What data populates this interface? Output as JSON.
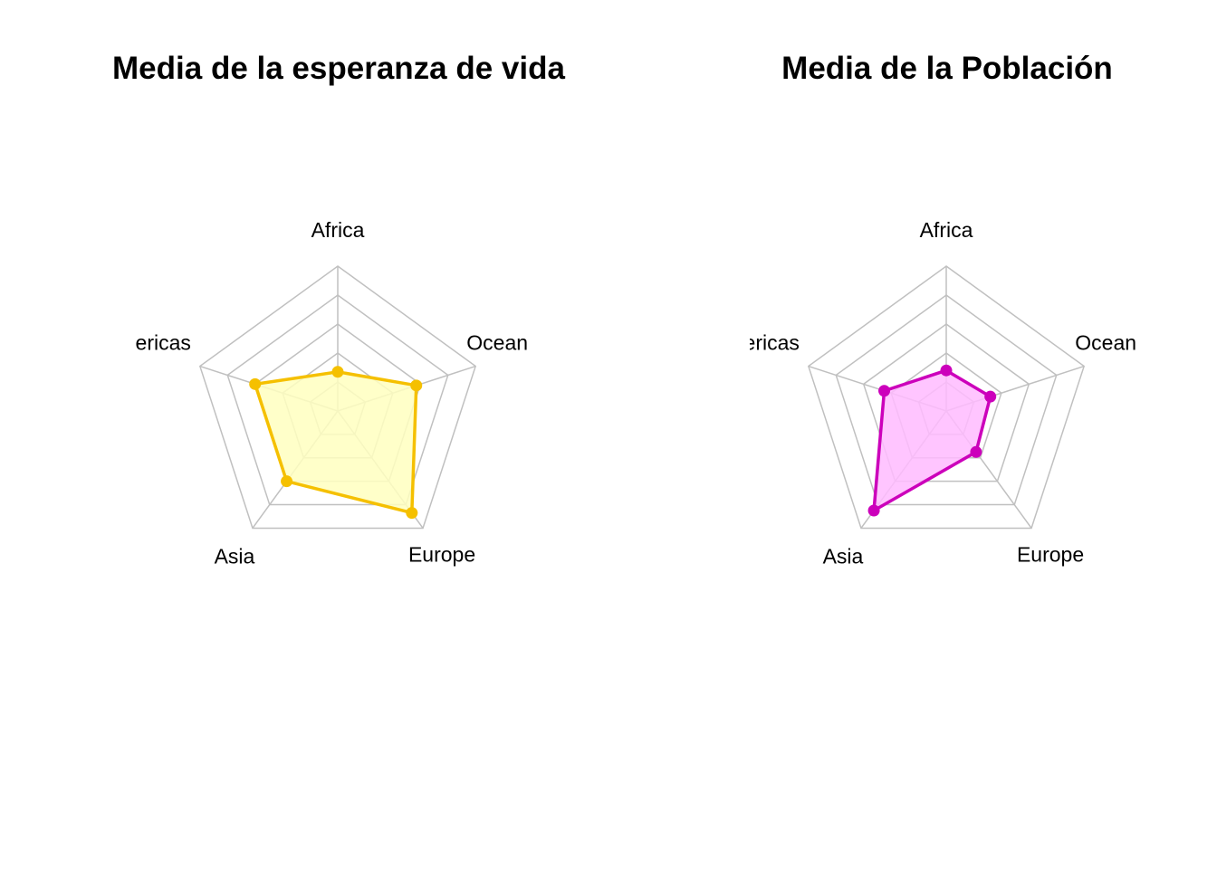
{
  "chart_data": [
    {
      "type": "radar",
      "title": "Media de la esperanza de vida",
      "axes": [
        "Africa",
        "Oceania",
        "Europe",
        "Asia",
        "Americas"
      ],
      "axis_labels_shown": [
        "Africa",
        "Ocean",
        "Europe",
        "Asia",
        "nericas"
      ],
      "scale": [
        0,
        1
      ],
      "rings": 5,
      "series": [
        {
          "values": [
            0.27,
            0.57,
            0.87,
            0.6,
            0.6
          ]
        }
      ],
      "line_color": "#f5c000",
      "fill_color": "#ffffc0"
    },
    {
      "type": "radar",
      "title": "Media de la Población",
      "axes": [
        "Africa",
        "Oceania",
        "Europe",
        "Asia",
        "Americas"
      ],
      "axis_labels_shown": [
        "Africa",
        "Ocean",
        "Europe",
        "Asia",
        "nericas"
      ],
      "scale": [
        0,
        1
      ],
      "rings": 5,
      "series": [
        {
          "values": [
            0.28,
            0.32,
            0.35,
            0.85,
            0.45
          ]
        }
      ],
      "line_color": "#cc00bb",
      "fill_color": "#ffbbff"
    }
  ]
}
